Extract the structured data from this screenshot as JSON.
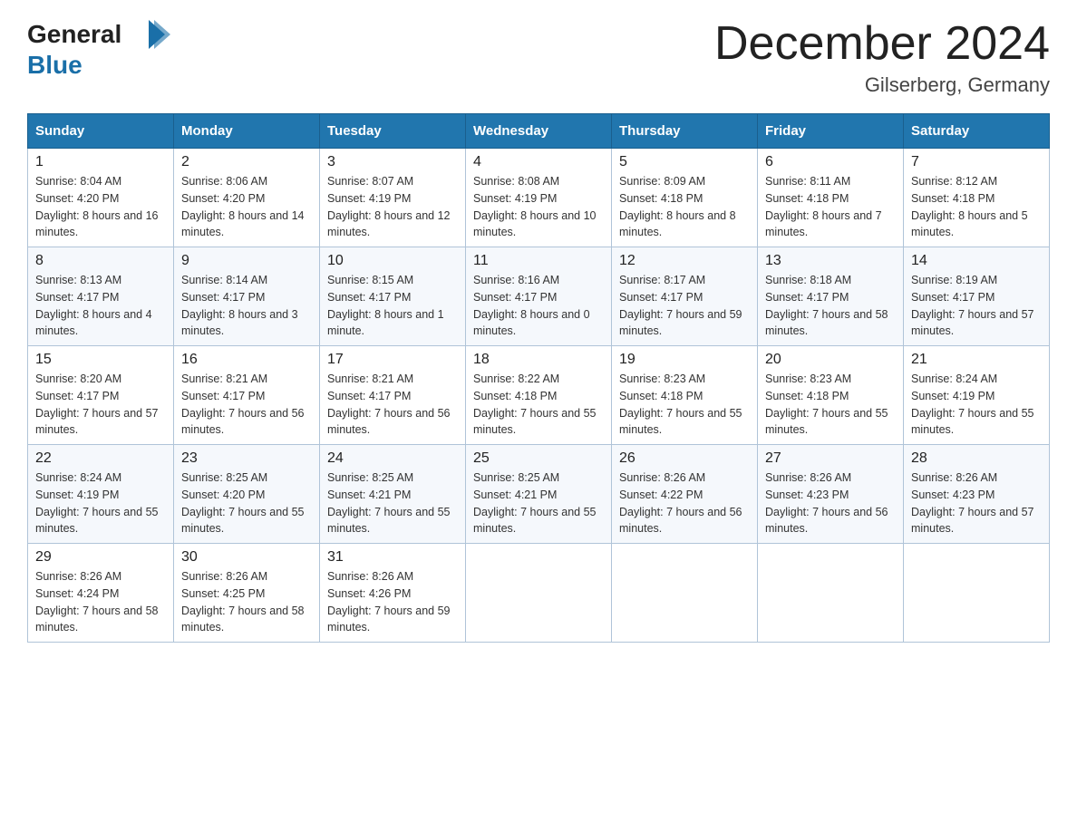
{
  "header": {
    "logo_general": "General",
    "logo_blue": "Blue",
    "title": "December 2024",
    "subtitle": "Gilserberg, Germany"
  },
  "days_of_week": [
    "Sunday",
    "Monday",
    "Tuesday",
    "Wednesday",
    "Thursday",
    "Friday",
    "Saturday"
  ],
  "weeks": [
    [
      {
        "num": "1",
        "sunrise": "8:04 AM",
        "sunset": "4:20 PM",
        "daylight": "8 hours and 16 minutes."
      },
      {
        "num": "2",
        "sunrise": "8:06 AM",
        "sunset": "4:20 PM",
        "daylight": "8 hours and 14 minutes."
      },
      {
        "num": "3",
        "sunrise": "8:07 AM",
        "sunset": "4:19 PM",
        "daylight": "8 hours and 12 minutes."
      },
      {
        "num": "4",
        "sunrise": "8:08 AM",
        "sunset": "4:19 PM",
        "daylight": "8 hours and 10 minutes."
      },
      {
        "num": "5",
        "sunrise": "8:09 AM",
        "sunset": "4:18 PM",
        "daylight": "8 hours and 8 minutes."
      },
      {
        "num": "6",
        "sunrise": "8:11 AM",
        "sunset": "4:18 PM",
        "daylight": "8 hours and 7 minutes."
      },
      {
        "num": "7",
        "sunrise": "8:12 AM",
        "sunset": "4:18 PM",
        "daylight": "8 hours and 5 minutes."
      }
    ],
    [
      {
        "num": "8",
        "sunrise": "8:13 AM",
        "sunset": "4:17 PM",
        "daylight": "8 hours and 4 minutes."
      },
      {
        "num": "9",
        "sunrise": "8:14 AM",
        "sunset": "4:17 PM",
        "daylight": "8 hours and 3 minutes."
      },
      {
        "num": "10",
        "sunrise": "8:15 AM",
        "sunset": "4:17 PM",
        "daylight": "8 hours and 1 minute."
      },
      {
        "num": "11",
        "sunrise": "8:16 AM",
        "sunset": "4:17 PM",
        "daylight": "8 hours and 0 minutes."
      },
      {
        "num": "12",
        "sunrise": "8:17 AM",
        "sunset": "4:17 PM",
        "daylight": "7 hours and 59 minutes."
      },
      {
        "num": "13",
        "sunrise": "8:18 AM",
        "sunset": "4:17 PM",
        "daylight": "7 hours and 58 minutes."
      },
      {
        "num": "14",
        "sunrise": "8:19 AM",
        "sunset": "4:17 PM",
        "daylight": "7 hours and 57 minutes."
      }
    ],
    [
      {
        "num": "15",
        "sunrise": "8:20 AM",
        "sunset": "4:17 PM",
        "daylight": "7 hours and 57 minutes."
      },
      {
        "num": "16",
        "sunrise": "8:21 AM",
        "sunset": "4:17 PM",
        "daylight": "7 hours and 56 minutes."
      },
      {
        "num": "17",
        "sunrise": "8:21 AM",
        "sunset": "4:17 PM",
        "daylight": "7 hours and 56 minutes."
      },
      {
        "num": "18",
        "sunrise": "8:22 AM",
        "sunset": "4:18 PM",
        "daylight": "7 hours and 55 minutes."
      },
      {
        "num": "19",
        "sunrise": "8:23 AM",
        "sunset": "4:18 PM",
        "daylight": "7 hours and 55 minutes."
      },
      {
        "num": "20",
        "sunrise": "8:23 AM",
        "sunset": "4:18 PM",
        "daylight": "7 hours and 55 minutes."
      },
      {
        "num": "21",
        "sunrise": "8:24 AM",
        "sunset": "4:19 PM",
        "daylight": "7 hours and 55 minutes."
      }
    ],
    [
      {
        "num": "22",
        "sunrise": "8:24 AM",
        "sunset": "4:19 PM",
        "daylight": "7 hours and 55 minutes."
      },
      {
        "num": "23",
        "sunrise": "8:25 AM",
        "sunset": "4:20 PM",
        "daylight": "7 hours and 55 minutes."
      },
      {
        "num": "24",
        "sunrise": "8:25 AM",
        "sunset": "4:21 PM",
        "daylight": "7 hours and 55 minutes."
      },
      {
        "num": "25",
        "sunrise": "8:25 AM",
        "sunset": "4:21 PM",
        "daylight": "7 hours and 55 minutes."
      },
      {
        "num": "26",
        "sunrise": "8:26 AM",
        "sunset": "4:22 PM",
        "daylight": "7 hours and 56 minutes."
      },
      {
        "num": "27",
        "sunrise": "8:26 AM",
        "sunset": "4:23 PM",
        "daylight": "7 hours and 56 minutes."
      },
      {
        "num": "28",
        "sunrise": "8:26 AM",
        "sunset": "4:23 PM",
        "daylight": "7 hours and 57 minutes."
      }
    ],
    [
      {
        "num": "29",
        "sunrise": "8:26 AM",
        "sunset": "4:24 PM",
        "daylight": "7 hours and 58 minutes."
      },
      {
        "num": "30",
        "sunrise": "8:26 AM",
        "sunset": "4:25 PM",
        "daylight": "7 hours and 58 minutes."
      },
      {
        "num": "31",
        "sunrise": "8:26 AM",
        "sunset": "4:26 PM",
        "daylight": "7 hours and 59 minutes."
      },
      null,
      null,
      null,
      null
    ]
  ],
  "labels": {
    "sunrise": "Sunrise:",
    "sunset": "Sunset:",
    "daylight": "Daylight:"
  }
}
